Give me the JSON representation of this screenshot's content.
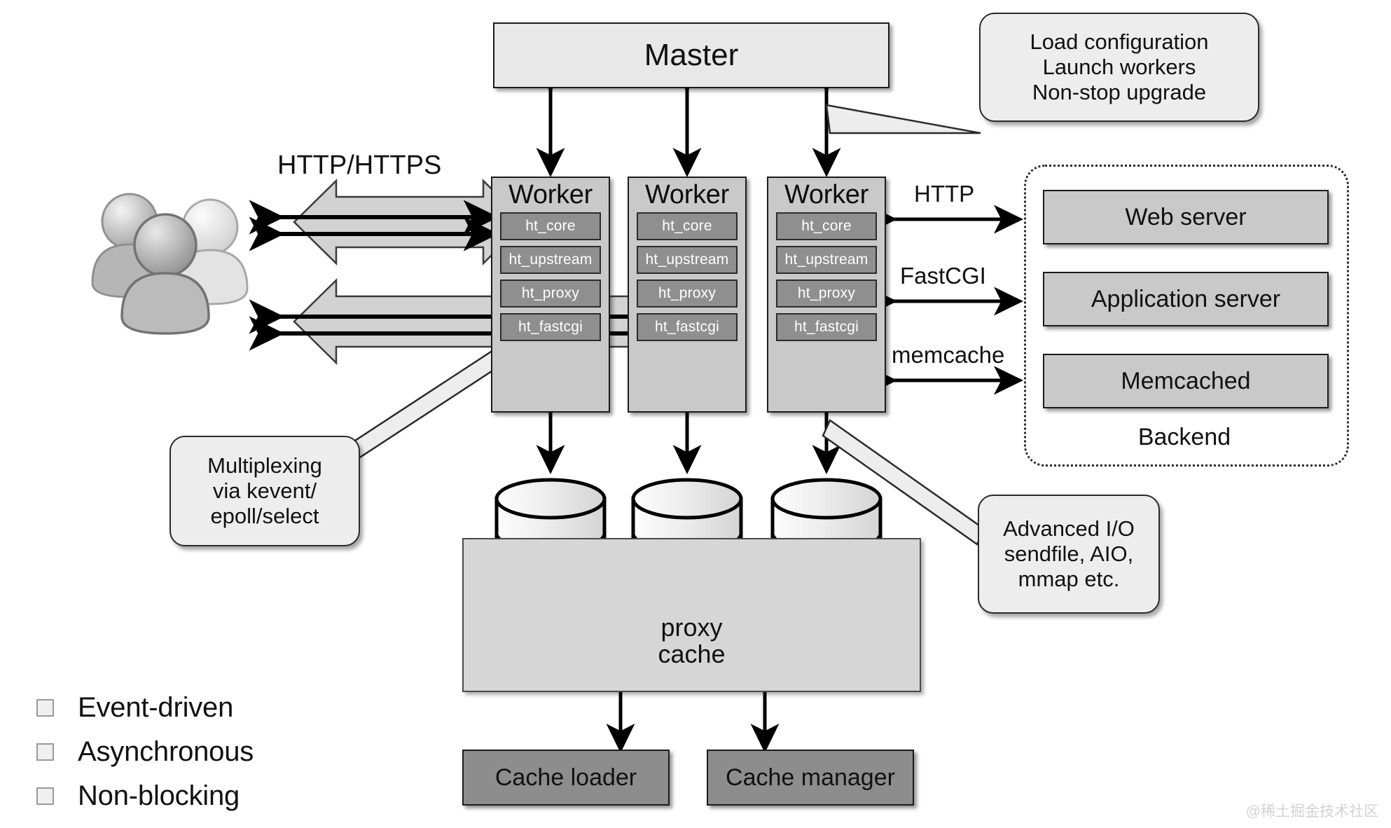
{
  "master": {
    "label": "Master"
  },
  "workers": [
    {
      "title": "Worker",
      "modules": [
        "ht_core",
        "ht_upstream",
        "ht_proxy",
        "ht_fastcgi"
      ]
    },
    {
      "title": "Worker",
      "modules": [
        "ht_core",
        "ht_upstream",
        "ht_proxy",
        "ht_fastcgi"
      ]
    },
    {
      "title": "Worker",
      "modules": [
        "ht_core",
        "ht_upstream",
        "ht_proxy",
        "ht_fastcgi"
      ]
    }
  ],
  "client": {
    "protocol_label": "HTTP/HTTPS",
    "icon": "users-group-icon"
  },
  "backend": {
    "caption": "Backend",
    "items": [
      "Web server",
      "Application server",
      "Memcached"
    ],
    "protocols": [
      "HTTP",
      "FastCGI",
      "memcache"
    ]
  },
  "cache": {
    "proxy_cache_line1": "proxy",
    "proxy_cache_line2": "cache",
    "loader": "Cache loader",
    "manager": "Cache manager"
  },
  "callouts": {
    "master": "Load configuration\nLaunch workers\nNon-stop upgrade",
    "multiplexing": "Multiplexing\nvia kevent/\nepoll/select",
    "advanced_io": "Advanced I/O\nsendfile, AIO,\nmmap etc."
  },
  "features": [
    "Event-driven",
    "Asynchronous",
    "Non-blocking"
  ],
  "watermark": "@稀土掘金技术社区",
  "colors": {
    "light_box": "#e8e8e8",
    "worker_box": "#c9c9c9",
    "module_box": "#8f8f8f",
    "dark_box": "#8d8d8d",
    "proxy_box": "#d6d6d6",
    "stroke": "#1b1b1b"
  }
}
